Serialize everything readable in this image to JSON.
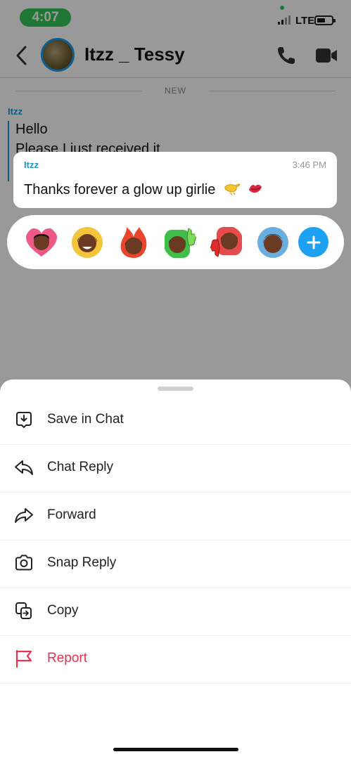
{
  "status_bar": {
    "time": "4:07",
    "network": "LTE"
  },
  "header": {
    "contact_name": "Itzz _ Tessy"
  },
  "chat": {
    "new_label": "NEW",
    "sender": "Itzz",
    "messages": [
      "Hello",
      "Please I just received it"
    ]
  },
  "selected_message": {
    "sender": "Itzz",
    "time": "3:46 PM",
    "text": "Thanks forever a glow up girlie"
  },
  "reactions": [
    "heart-bitmoji",
    "laughing-bitmoji",
    "fire-bitmoji",
    "thumbs-up-bitmoji",
    "thumbs-down-bitmoji",
    "plain-bitmoji",
    "add-reaction"
  ],
  "menu": [
    {
      "label": "Save in Chat",
      "icon": "save-in-chat-icon"
    },
    {
      "label": "Chat Reply",
      "icon": "reply-arrow-icon"
    },
    {
      "label": "Forward",
      "icon": "forward-arrow-icon"
    },
    {
      "label": "Snap Reply",
      "icon": "camera-icon"
    },
    {
      "label": "Copy",
      "icon": "copy-icon"
    },
    {
      "label": "Report",
      "icon": "flag-icon"
    }
  ],
  "colors": {
    "accent": "#1c97d1",
    "danger": "#e8324f",
    "add_button": "#1ea1f2",
    "status_green": "#34c759"
  }
}
